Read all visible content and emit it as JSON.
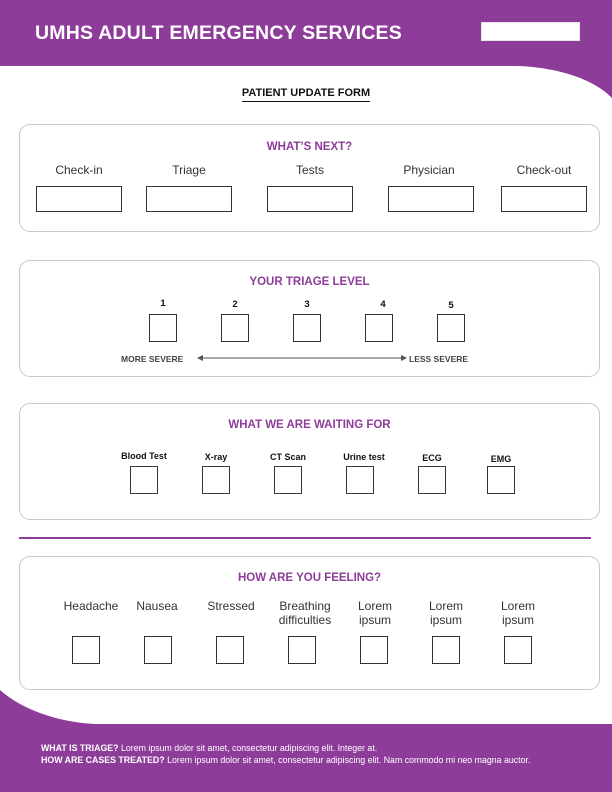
{
  "header": {
    "title": "UMHS ADULT EMERGENCY SERVICES"
  },
  "form_title": "PATIENT UPDATE FORM",
  "whats_next": {
    "title": "WHAT’S NEXT?",
    "steps": [
      "Check-in",
      "Triage",
      "Tests",
      "Physician",
      "Check-out"
    ]
  },
  "triage": {
    "title": "YOUR TRIAGE LEVEL",
    "levels": [
      "1",
      "2",
      "3",
      "4",
      "5"
    ],
    "more_severe": "MORE SEVERE",
    "less_severe": "LESS SEVERE"
  },
  "waiting": {
    "title": "WHAT WE ARE WAITING FOR",
    "items": [
      "Blood Test",
      "X-ray",
      "CT Scan",
      "Urine test",
      "ECG",
      "EMG"
    ]
  },
  "feeling": {
    "title": "HOW ARE YOU FEELING?",
    "items": [
      "Headache",
      "Nausea",
      "Stressed",
      "Breathing difficulties",
      "Lorem ipsum",
      "Lorem ipsum",
      "Lorem ipsum"
    ]
  },
  "footer": {
    "q1": "WHAT IS TRIAGE?",
    "a1": "Lorem ipsum dolor sit amet, consectetur adipiscing elit. Integer at.",
    "q2": "HOW ARE CASES TREATED?",
    "a2": "Lorem ipsum dolor sit amet, consectetur adipiscing elit. Nam commodo mi neo magna auctor."
  },
  "colors": {
    "brand": "#8e3c9a",
    "border": "#c8c8c8"
  }
}
